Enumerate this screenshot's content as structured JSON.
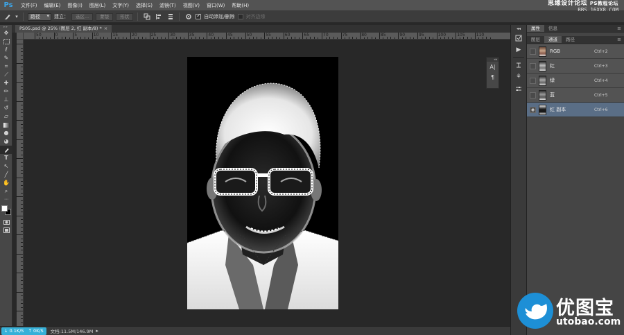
{
  "app": {
    "logo": "Ps",
    "menu": [
      "文件(F)",
      "编辑(E)",
      "图像(I)",
      "图层(L)",
      "文字(Y)",
      "选择(S)",
      "滤镜(T)",
      "视图(V)",
      "窗口(W)",
      "帮助(H)"
    ],
    "watermark_title": "思缘设计论坛",
    "watermark_url": "BBS.16XX8.COM",
    "watermark_tag": "PS教程论坛"
  },
  "options": {
    "mode_select": "路径",
    "make_label": "建立：",
    "selection_btn": "选区...",
    "mask_btn": "蒙版",
    "shape_btn": "形状",
    "auto_add_delete": "自动添加/删除",
    "align_edges": "对齐边缘"
  },
  "toolbar": {
    "tools": [
      "move-tool",
      "marquee-tool",
      "lasso-tool",
      "quick-select-tool",
      "crop-tool",
      "eyedropper-tool",
      "healing-brush-tool",
      "brush-tool",
      "clone-stamp-tool",
      "history-brush-tool",
      "eraser-tool",
      "gradient-tool",
      "blur-tool",
      "dodge-tool",
      "pen-tool",
      "type-tool",
      "path-selection-tool",
      "line-tool",
      "hand-tool",
      "zoom-tool"
    ],
    "active_tool": "pen-tool",
    "foreground_color": "#ffffff",
    "background_color": "#000000"
  },
  "document": {
    "tab_title": "PS05.psd @ 25% (图层 2, 红 副本/8) *",
    "ruler_labels": [
      "50",
      "0",
      "5",
      "10",
      "15",
      "20",
      "25",
      "30",
      "35",
      "40",
      "45",
      "50",
      "55",
      "60",
      "65",
      "70",
      "75",
      "80",
      "85",
      "90",
      "95",
      "100",
      "105",
      "110"
    ]
  },
  "status": {
    "upload_speed": "0.1K/S",
    "download_speed": "0K/S",
    "doc_info": "文档:11.5M/146.9M"
  },
  "panels": {
    "top_tabs": [
      "属性",
      "信息"
    ],
    "top_active": "属性",
    "channel_tabs": [
      "图层",
      "通道",
      "路径"
    ],
    "channel_active": "通道",
    "channels": [
      {
        "name": "RGB",
        "shortcut": "Ctrl+2",
        "visible": false,
        "selected": false,
        "thumb": "color"
      },
      {
        "name": "红",
        "shortcut": "Ctrl+3",
        "visible": false,
        "selected": false,
        "thumb": "gray"
      },
      {
        "name": "绿",
        "shortcut": "Ctrl+4",
        "visible": false,
        "selected": false,
        "thumb": "gray"
      },
      {
        "name": "蓝",
        "shortcut": "Ctrl+5",
        "visible": false,
        "selected": false,
        "thumb": "gray"
      },
      {
        "name": "红 副本",
        "shortcut": "Ctrl+6",
        "visible": true,
        "selected": true,
        "thumb": "inverted"
      }
    ]
  },
  "brand": {
    "name": "优图宝",
    "url": "utobao.com",
    "color": "#1d8fd6"
  }
}
